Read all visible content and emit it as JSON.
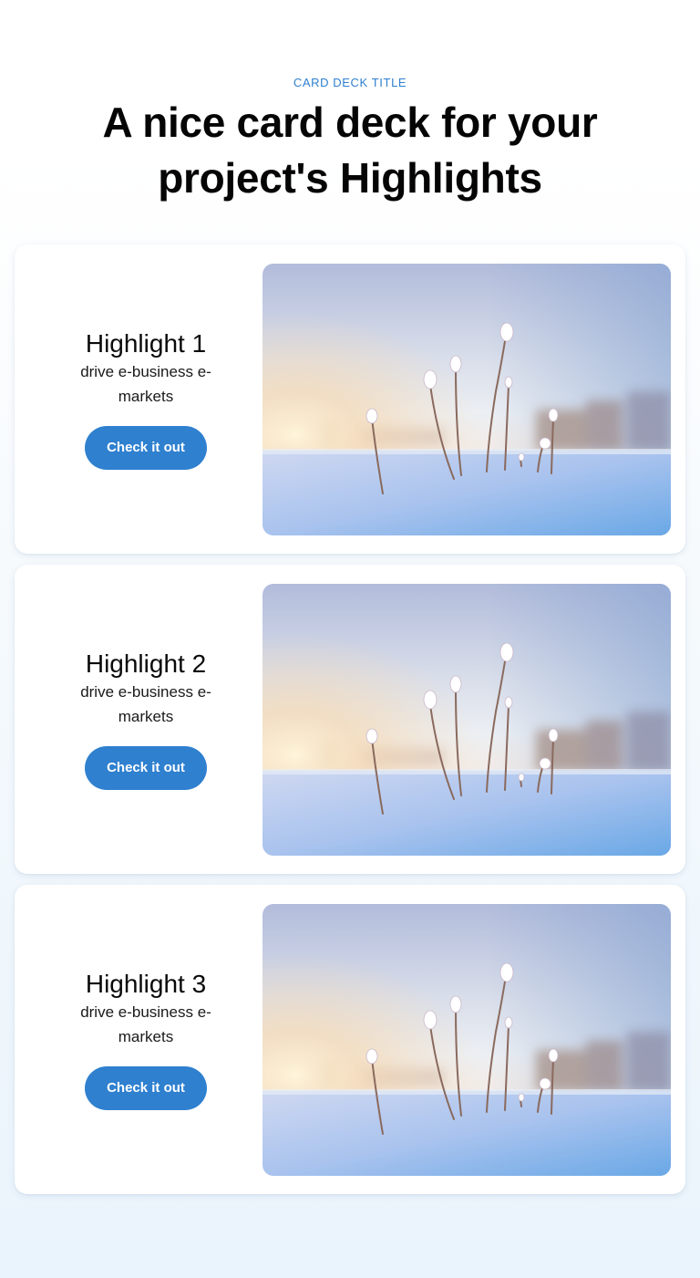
{
  "header": {
    "eyebrow": "CARD DECK TITLE",
    "title": "A nice card deck for your project's Highlights"
  },
  "cards": [
    {
      "title": "Highlight 1",
      "description": "drive e-business e-markets",
      "button_label": "Check it out",
      "image": "winter-snow-plants-photo"
    },
    {
      "title": "Highlight 2",
      "description": "drive e-business e-markets",
      "button_label": "Check it out",
      "image": "winter-snow-plants-photo"
    },
    {
      "title": "Highlight 3",
      "description": "drive e-business e-markets",
      "button_label": "Check it out",
      "image": "winter-snow-plants-photo"
    }
  ],
  "colors": {
    "accent": "#2f80cf",
    "title": "#050505",
    "card_bg": "#ffffff"
  }
}
